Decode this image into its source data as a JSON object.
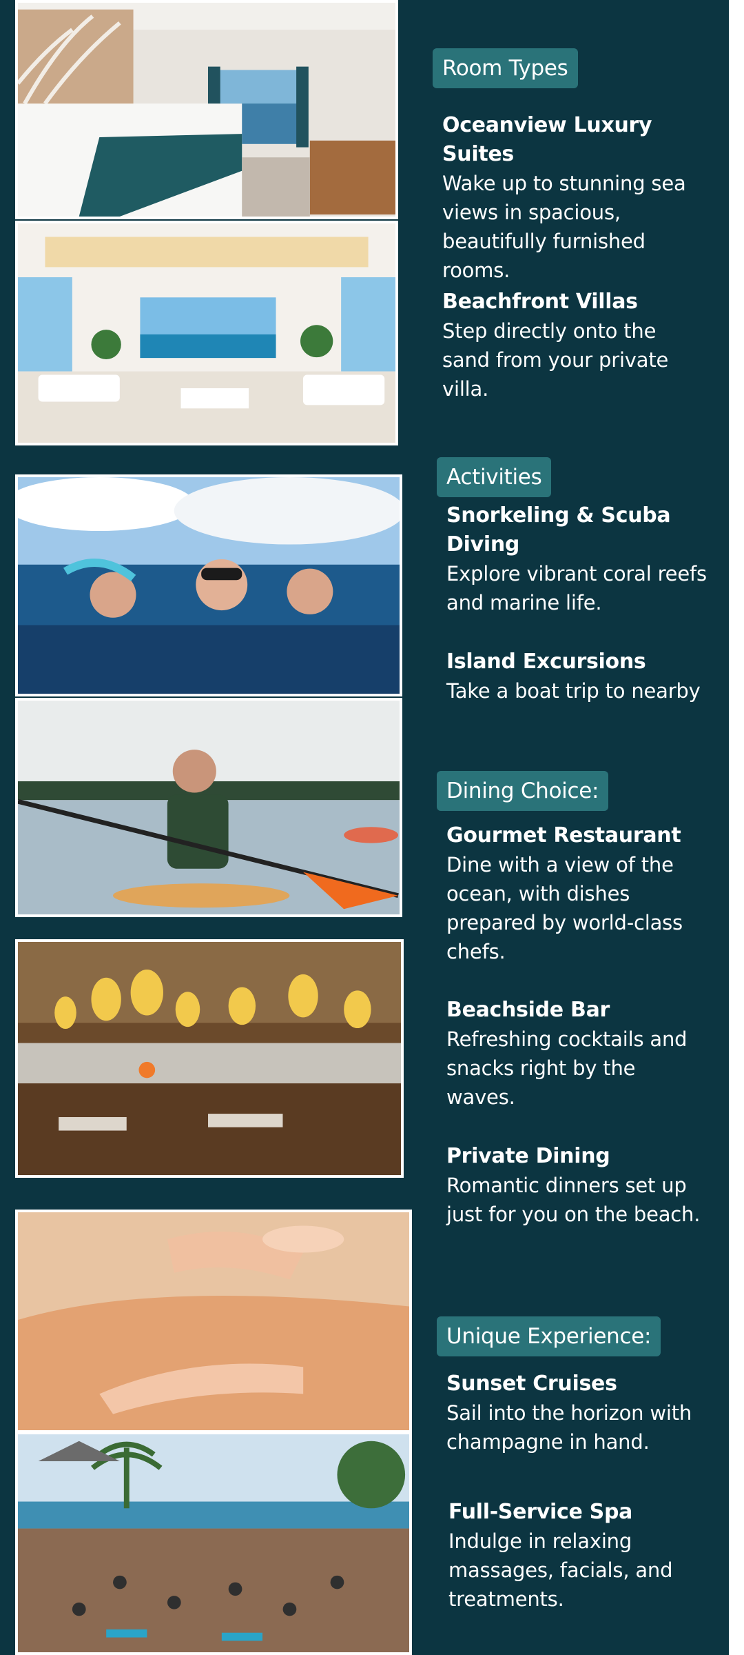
{
  "colors": {
    "panel": "#0c3541",
    "badge": "#2a7379",
    "text": "#ffffff"
  },
  "sections": [
    {
      "heading": "Room Types",
      "items": [
        {
          "title": "Oceanview Luxury Suites",
          "desc": "Wake up to stunning sea views in spacious, beautifully furnished rooms."
        },
        {
          "title": "Beachfront Villas",
          "desc": "Step directly onto the sand from your private villa."
        }
      ]
    },
    {
      "heading": "Activities",
      "items": [
        {
          "title": "Snorkeling & Scuba Diving",
          "desc": "Explore vibrant coral reefs and marine life."
        },
        {
          "title": "Island Excursions",
          "desc": "Take a boat trip to nearby"
        }
      ]
    },
    {
      "heading": "Dining Choice:",
      "items": [
        {
          "title": "Gourmet Restaurant",
          "desc": "Dine with a view of the ocean, with dishes prepared by world-class chefs."
        },
        {
          "title": "Beachside Bar",
          "desc": "Refreshing cocktails and snacks right by the waves."
        },
        {
          "title": "Private Dining",
          "desc": "Romantic dinners set up just for you on the beach."
        }
      ]
    },
    {
      "heading": "Unique Experience:",
      "items": [
        {
          "title": "Sunset Cruises",
          "desc": "Sail into the horizon with champagne in hand."
        },
        {
          "title": "Full-Service Spa",
          "desc": "Indulge in relaxing massages, facials, and treatments."
        }
      ]
    }
  ]
}
